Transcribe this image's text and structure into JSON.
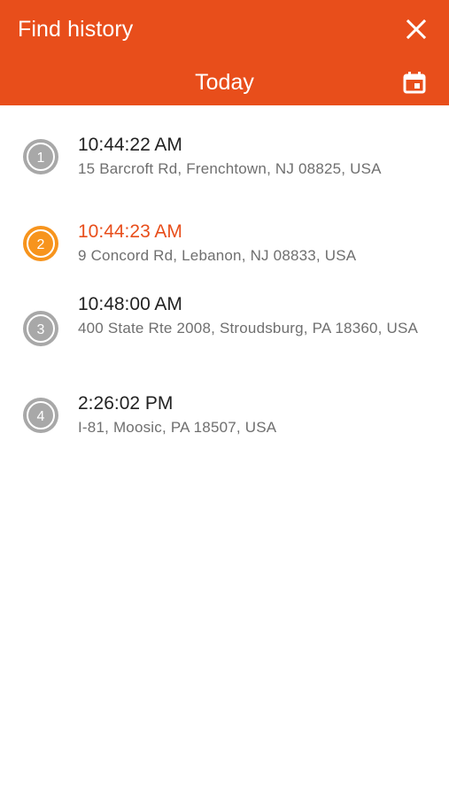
{
  "header": {
    "title": "Find history",
    "day": "Today",
    "close_icon": "close-icon",
    "calendar_icon": "calendar-icon",
    "background_color": "#e84e1b"
  },
  "history": {
    "items": [
      {
        "number": "1",
        "time": "10:44:22 AM",
        "address": "15 Barcroft Rd, Frenchtown, NJ 08825, USA",
        "active": false
      },
      {
        "number": "2",
        "time": "10:44:23 AM",
        "address": "9 Concord Rd, Lebanon, NJ 08833, USA",
        "active": true
      },
      {
        "number": "3",
        "time": "10:48:00 AM",
        "address": "400 State Rte 2008, Stroudsburg, PA 18360, USA",
        "active": false
      },
      {
        "number": "4",
        "time": "2:26:02 PM",
        "address": "I-81, Moosic, PA 18507, USA",
        "active": false
      }
    ]
  },
  "colors": {
    "accent": "#e84e1b",
    "active_marker": "#f7941d",
    "inactive_marker": "#a8a8a8"
  }
}
